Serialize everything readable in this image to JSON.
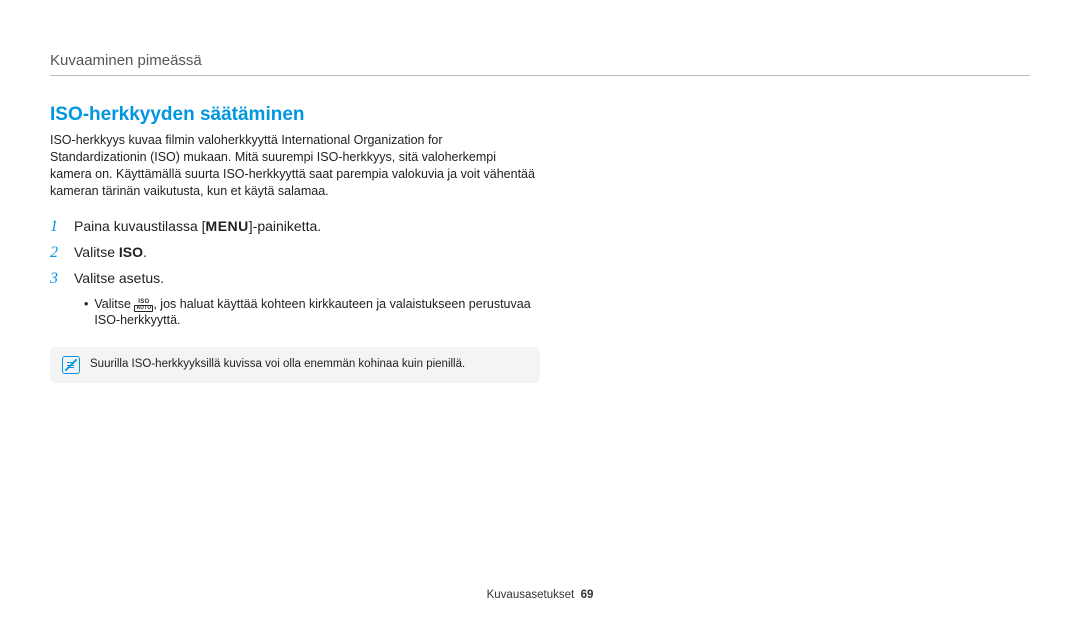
{
  "header": {
    "breadcrumb": "Kuvaaminen pimeässä"
  },
  "section": {
    "heading": "ISO-herkkyyden säätäminen",
    "intro": "ISO-herkkyys kuvaa filmin valoherkkyyttä International Organization for Standardizationin (ISO) mukaan. Mitä suurempi ISO-herkkyys, sitä valoherkempi kamera on. Käyttämällä suurta ISO-herkkyyttä saat parempia valokuvia ja voit vähentää kameran tärinän vaikutusta, kun et käytä salamaa."
  },
  "steps": [
    {
      "num": "1",
      "prefix": "Paina kuvaustilassa [",
      "menu": "MENU",
      "suffix": "]-painiketta."
    },
    {
      "num": "2",
      "prefix": "Valitse ",
      "bold": "ISO",
      "suffix": "."
    },
    {
      "num": "3",
      "prefix": "Valitse asetus."
    }
  ],
  "bullet": {
    "prefix": "Valitse ",
    "icon_top": "ISO",
    "icon_bottom": "AUTO",
    "suffix": ", jos haluat käyttää kohteen kirkkauteen ja valaistukseen perustuvaa ISO-herkkyyttä."
  },
  "note": "Suurilla ISO-herkkyyksillä kuvissa voi olla enemmän kohinaa kuin pienillä.",
  "footer": {
    "section": "Kuvausasetukset",
    "page": "69"
  }
}
